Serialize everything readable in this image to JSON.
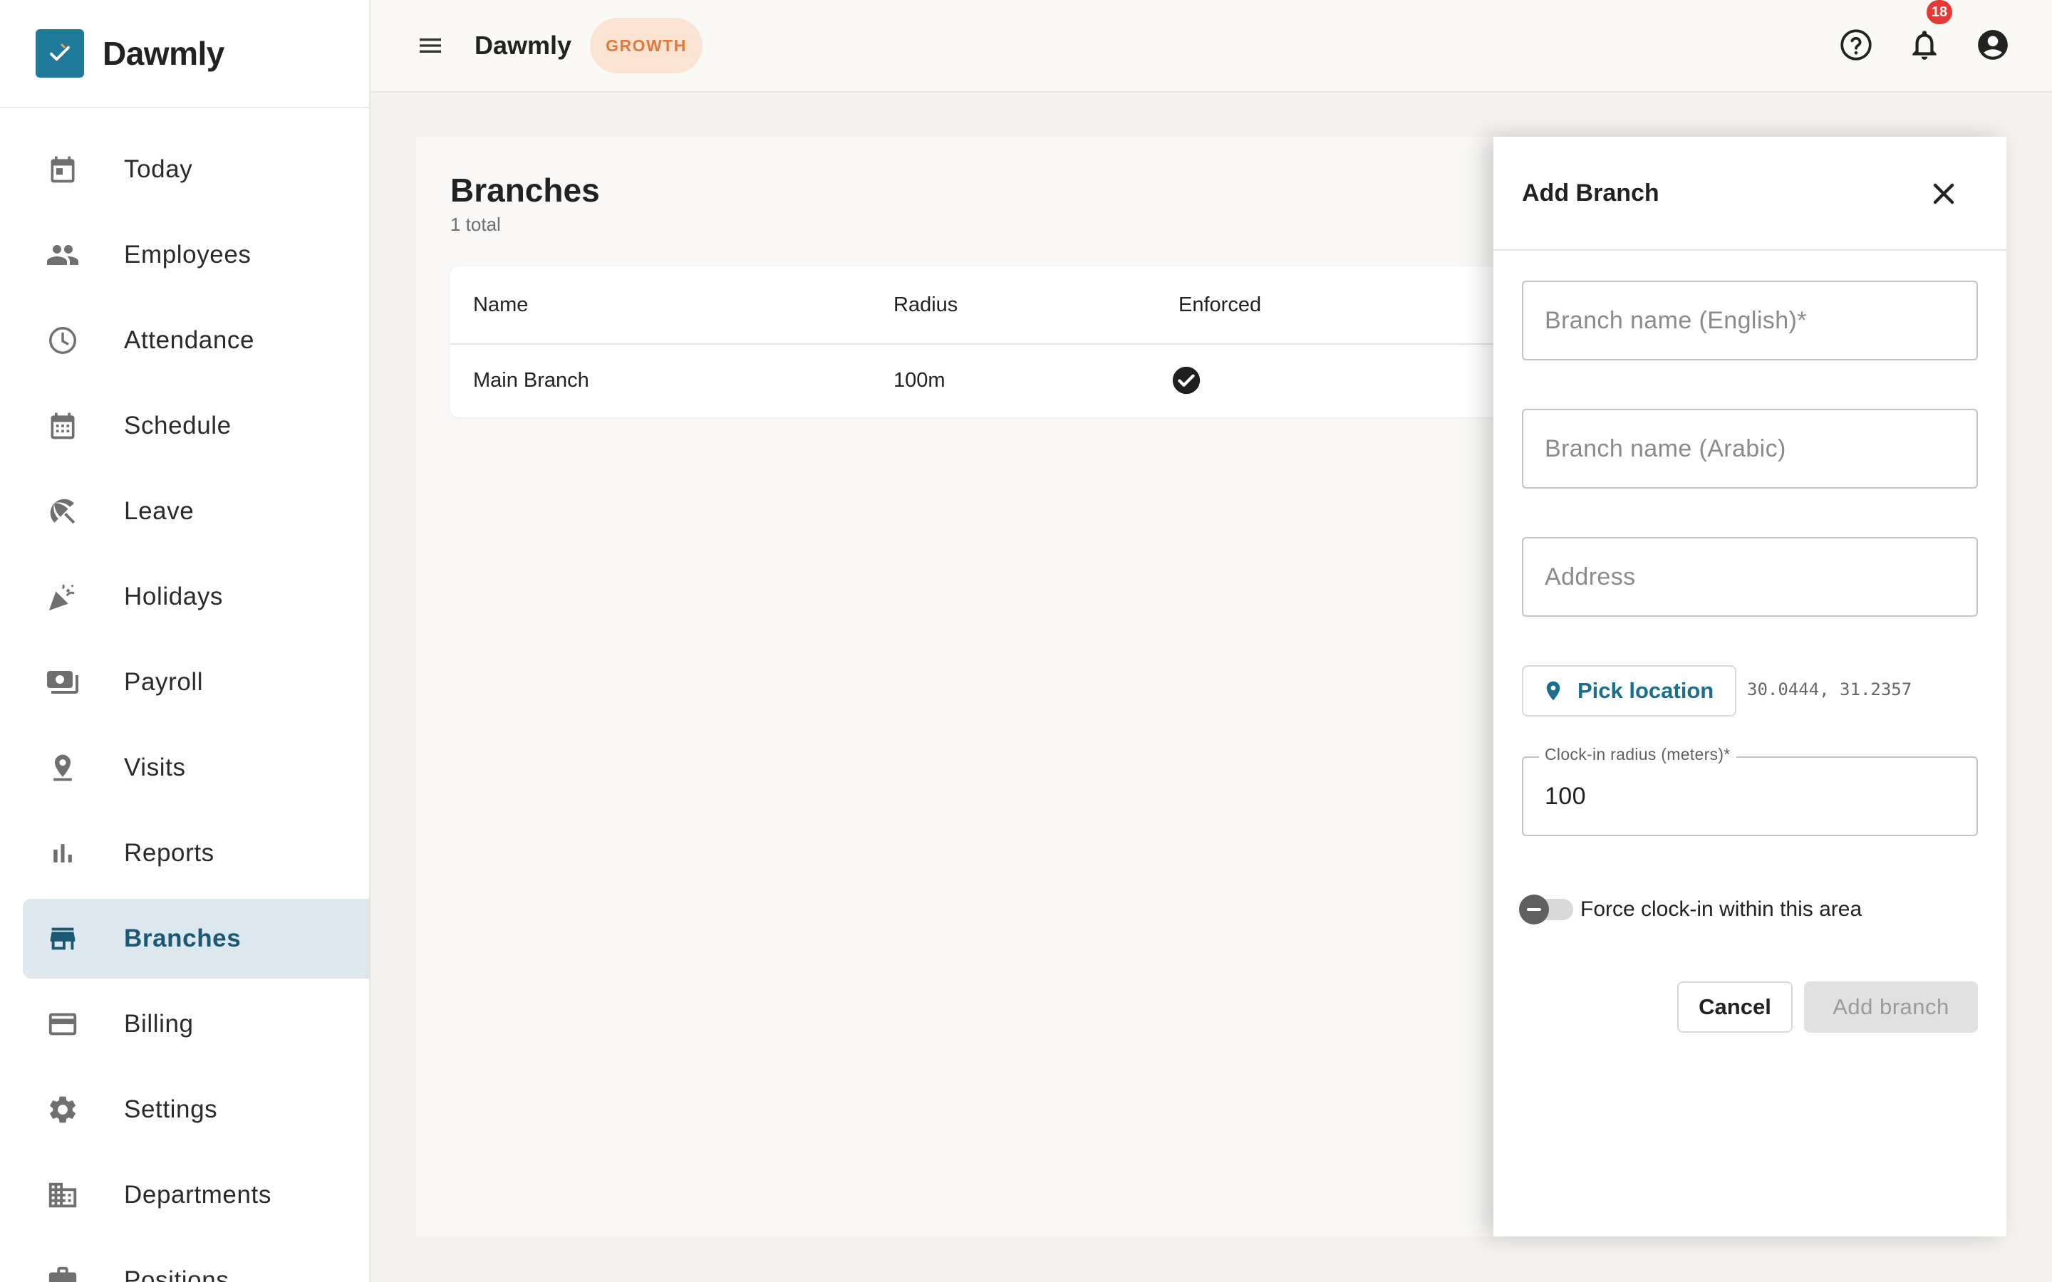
{
  "app": {
    "name": "Dawmly",
    "plan_badge": "GROWTH"
  },
  "topbar": {
    "title": "Dawmly",
    "notification_count": "18"
  },
  "sidebar": {
    "items": [
      {
        "label": "Today",
        "icon": "calendar-today-icon",
        "active": false
      },
      {
        "label": "Employees",
        "icon": "people-icon",
        "active": false
      },
      {
        "label": "Attendance",
        "icon": "clock-icon",
        "active": false
      },
      {
        "label": "Schedule",
        "icon": "calendar-grid-icon",
        "active": false
      },
      {
        "label": "Leave",
        "icon": "beach-umbrella-icon",
        "active": false
      },
      {
        "label": "Holidays",
        "icon": "party-popper-icon",
        "active": false
      },
      {
        "label": "Payroll",
        "icon": "money-icon",
        "active": false
      },
      {
        "label": "Visits",
        "icon": "location-pin-icon",
        "active": false
      },
      {
        "label": "Reports",
        "icon": "bar-chart-icon",
        "active": false
      },
      {
        "label": "Branches",
        "icon": "store-icon",
        "active": true
      },
      {
        "label": "Billing",
        "icon": "credit-card-icon",
        "active": false
      },
      {
        "label": "Settings",
        "icon": "gear-icon",
        "active": false
      },
      {
        "label": "Departments",
        "icon": "building-icon",
        "active": false
      },
      {
        "label": "Positions",
        "icon": "briefcase-icon",
        "active": false
      }
    ]
  },
  "main": {
    "title": "Branches",
    "subtitle": "1 total",
    "table": {
      "columns": [
        "Name",
        "Radius",
        "Enforced"
      ],
      "rows": [
        {
          "name": "Main Branch",
          "radius": "100m",
          "enforced": true
        }
      ]
    }
  },
  "drawer": {
    "title": "Add Branch",
    "fields": {
      "name_en": {
        "placeholder": "Branch name (English)*",
        "value": ""
      },
      "name_ar": {
        "placeholder": "Branch name (Arabic)",
        "value": ""
      },
      "address": {
        "placeholder": "Address",
        "value": ""
      },
      "radius": {
        "label": "Clock-in radius (meters)*",
        "value": "100"
      }
    },
    "pick_location_label": "Pick location",
    "coordinates": "30.0444, 31.2357",
    "force_clockin_label": "Force clock-in within this area",
    "force_clockin_state": "indeterminate",
    "cancel_label": "Cancel",
    "submit_label": "Add branch"
  },
  "colors": {
    "brand": "#1f7a99",
    "accent_text": "#1b6e8e",
    "active_nav_bg": "#dce7ee",
    "badge_bg": "#fbe3d2",
    "badge_text": "#e07a3c",
    "notification": "#e53935"
  }
}
